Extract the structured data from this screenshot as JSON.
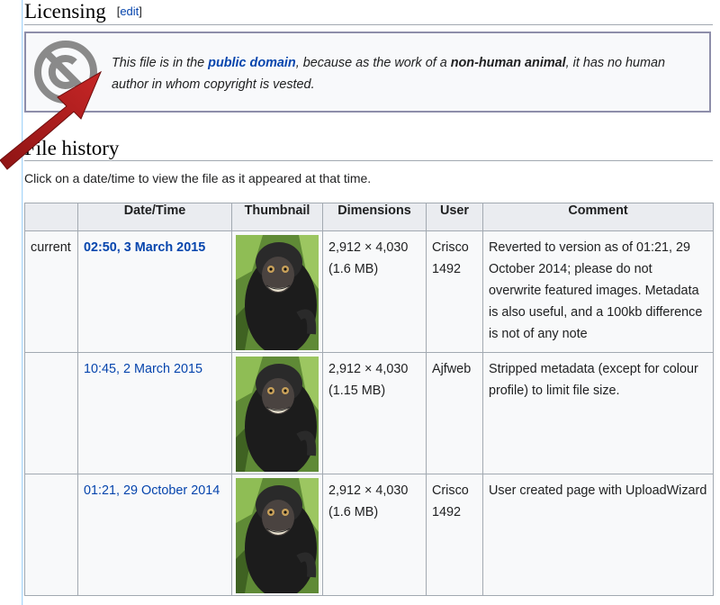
{
  "licensing": {
    "heading": "Licensing",
    "edit_label": "edit",
    "text_pre": "This file is in the ",
    "public_domain_link": "public domain",
    "text_mid": ", because as the work of a ",
    "non_human": "non-human animal",
    "text_post": ", it has no human author in whom copyright is vested."
  },
  "file_history": {
    "heading": "File history",
    "intro": "Click on a date/time to view the file as it appeared at that time.",
    "columns": [
      "",
      "Date/Time",
      "Thumbnail",
      "Dimensions",
      "User",
      "Comment"
    ],
    "rows": [
      {
        "status": "current",
        "datetime": "02:50, 3 March 2015",
        "dimensions": "2,912 × 4,030",
        "size": "(1.6 MB)",
        "user_line1": "Crisco",
        "user_line2": "1492",
        "comment": "Reverted to version as of 01:21, 29 October 2014; please do not overwrite featured images. Metadata is also useful, and a 100kb difference is not of any note"
      },
      {
        "status": "",
        "datetime": "10:45, 2 March 2015",
        "dimensions": "2,912 × 4,030",
        "size": "(1.15 MB)",
        "user_line1": "Ajfweb",
        "user_line2": "",
        "comment": "Stripped metadata (except for colour profile) to limit file size."
      },
      {
        "status": "",
        "datetime": "01:21, 29 October 2014",
        "dimensions": "2,912 × 4,030",
        "size": "(1.6 MB)",
        "user_line1": "Crisco",
        "user_line2": "1492",
        "comment": "User created page with UploadWizard"
      }
    ]
  },
  "colors": {
    "link": "#0645ad",
    "arrow": "#b01c1c",
    "header_bg": "#eaecf0",
    "cell_bg": "#f8f9fa"
  },
  "icons": {
    "license": "public-domain-icon",
    "annotation": "red-arrow-icon",
    "thumbnail": "macaque-thumbnail"
  }
}
